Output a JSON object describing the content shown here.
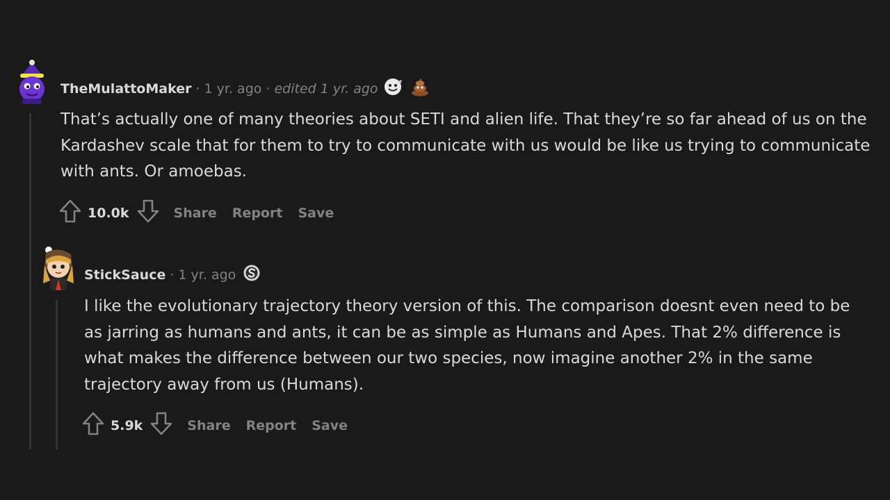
{
  "comments": [
    {
      "username": "TheMulattoMaker",
      "time": "1 yr. ago",
      "edited": "edited 1 yr. ago",
      "awards": [
        "wholesome-award-icon",
        "poop-award-icon"
      ],
      "body": "That’s actually one of many theories about SETI and alien life. That they’re so far ahead of us on the Kardashev scale that for them to try to communicate with us would be like us trying to communicate with ants. Or amoebas.",
      "score": "10.0k",
      "actions": {
        "share": "Share",
        "report": "Report",
        "save": "Save"
      }
    },
    {
      "username": "StickSauce",
      "time": "1 yr. ago",
      "awards": [
        "silver-award-icon"
      ],
      "body": "I like the evolutionary trajectory theory version of this. The comparison doesnt even need to be as jarring as humans and ants, it can be as simple as Humans and Apes. That 2% difference is what makes the difference between our two species, now imagine another 2% in the same trajectory away from us (Humans).",
      "score": "5.9k",
      "actions": {
        "share": "Share",
        "report": "Report",
        "save": "Save"
      }
    }
  ],
  "separator": "·",
  "colors": {
    "background": "#1a1a1b",
    "text": "#d7dadc",
    "meta": "#818384",
    "thread_line": "#343536"
  }
}
